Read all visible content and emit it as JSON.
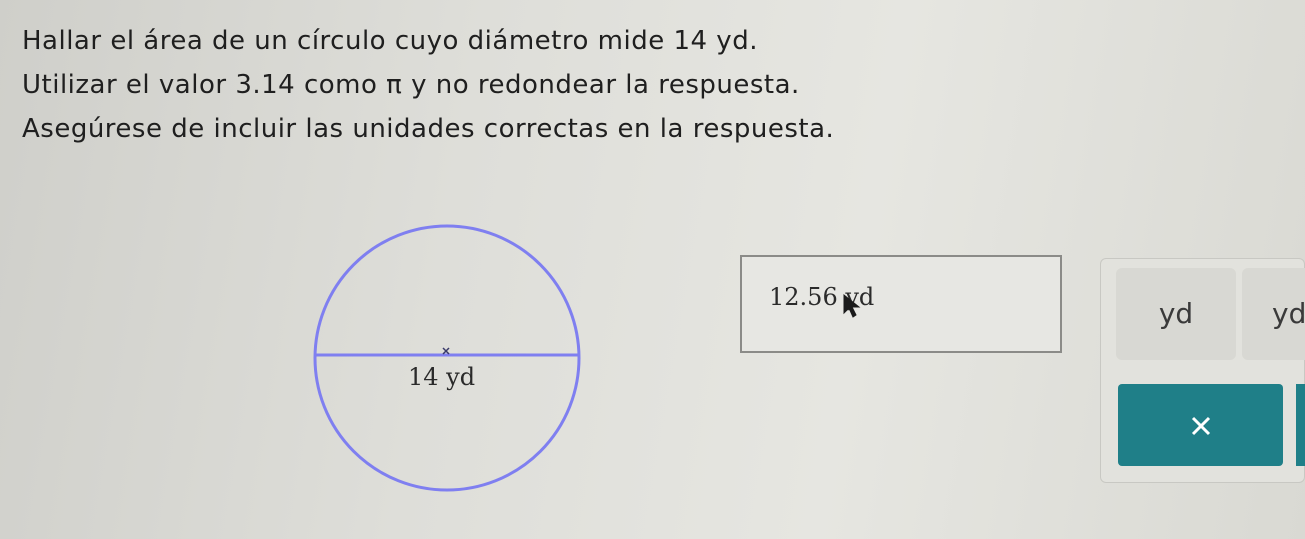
{
  "problem": {
    "line1": "Hallar el área de un círculo cuyo diámetro mide 14 yd.",
    "line2": "Utilizar el valor 3.14 como π y no redondear la respuesta.",
    "line3": "Asegúrese de incluir las unidades correctas en la respuesta."
  },
  "figure": {
    "diameter_label": "14 yd",
    "circle_color": "#7f7ff0"
  },
  "answer": {
    "value": "12.56 yd"
  },
  "keypad": {
    "unit_key_1": "yd",
    "unit_key_2": "yd",
    "clear_icon": "x-icon",
    "accent_color": "#1f7f88"
  }
}
